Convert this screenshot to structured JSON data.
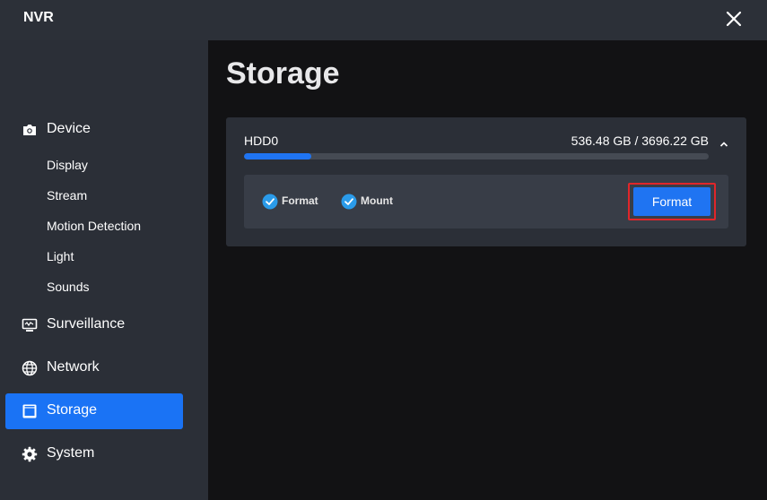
{
  "app": {
    "title": "NVR"
  },
  "sidebar": {
    "device": {
      "label": "Device",
      "icon": "camera-icon",
      "subitems": [
        "Display",
        "Stream",
        "Motion Detection",
        "Light",
        "Sounds"
      ]
    },
    "items": [
      {
        "label": "Surveillance",
        "icon": "monitor-icon"
      },
      {
        "label": "Network",
        "icon": "globe-icon"
      },
      {
        "label": "Storage",
        "icon": "storage-icon",
        "active": true
      },
      {
        "label": "System",
        "icon": "gear-icon"
      }
    ]
  },
  "main": {
    "title": "Storage",
    "disk": {
      "name": "HDD0",
      "usage": "536.48 GB / 3696.22 GB",
      "used_fraction": 0.145,
      "options": [
        {
          "label": "Format",
          "checked": true
        },
        {
          "label": "Mount",
          "checked": true
        }
      ],
      "format_button": "Format"
    }
  },
  "colors": {
    "accent": "#1a73f5",
    "highlight_border": "#e0262a",
    "check": "#2a9bea"
  }
}
